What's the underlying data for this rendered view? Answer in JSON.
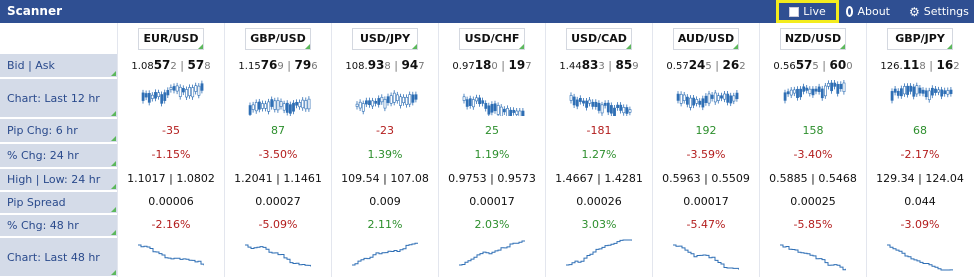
{
  "title": "Scanner",
  "toolbar": {
    "live": "Live",
    "about": "About",
    "settings": "Settings"
  },
  "row_labels": [
    "Bid | Ask",
    "Chart: Last 12 hr",
    "Pip Chg: 6 hr",
    "% Chg: 24 hr",
    "High | Low: 24 hr",
    "Pip Spread",
    "% Chg: 48 hr",
    "Chart: Last 48 hr"
  ],
  "pairs": [
    {
      "name": "EUR/USD",
      "bid_a": "1.08",
      "bid_b": "57",
      "bid_c": "2",
      "ask_a": "57",
      "ask_b": "8",
      "pip6": "-35",
      "pip6_dir": "neg",
      "chg24": "-1.15%",
      "chg24_dir": "neg",
      "high": "1.1017",
      "low": "1.0802",
      "spread": "0.00006",
      "chg48": "-2.16%",
      "chg48_dir": "neg"
    },
    {
      "name": "GBP/USD",
      "bid_a": "1.15",
      "bid_b": "76",
      "bid_c": "9",
      "ask_a": "79",
      "ask_b": "6",
      "pip6": "87",
      "pip6_dir": "pos",
      "chg24": "-3.50%",
      "chg24_dir": "neg",
      "high": "1.2041",
      "low": "1.1461",
      "spread": "0.00027",
      "chg48": "-5.09%",
      "chg48_dir": "neg"
    },
    {
      "name": "USD/JPY",
      "bid_a": "108.",
      "bid_b": "93",
      "bid_c": "8",
      "ask_a": "94",
      "ask_b": "7",
      "pip6": "-23",
      "pip6_dir": "neg",
      "chg24": "1.39%",
      "chg24_dir": "pos",
      "high": "109.54",
      "low": "107.08",
      "spread": "0.009",
      "chg48": "2.11%",
      "chg48_dir": "pos"
    },
    {
      "name": "USD/CHF",
      "bid_a": "0.97",
      "bid_b": "18",
      "bid_c": "0",
      "ask_a": "19",
      "ask_b": "7",
      "pip6": "25",
      "pip6_dir": "pos",
      "chg24": "1.19%",
      "chg24_dir": "pos",
      "high": "0.9753",
      "low": "0.9573",
      "spread": "0.00017",
      "chg48": "2.03%",
      "chg48_dir": "pos"
    },
    {
      "name": "USD/CAD",
      "bid_a": "1.44",
      "bid_b": "83",
      "bid_c": "3",
      "ask_a": "85",
      "ask_b": "9",
      "pip6": "-181",
      "pip6_dir": "neg",
      "chg24": "1.27%",
      "chg24_dir": "pos",
      "high": "1.4667",
      "low": "1.4281",
      "spread": "0.00026",
      "chg48": "3.03%",
      "chg48_dir": "pos"
    },
    {
      "name": "AUD/USD",
      "bid_a": "0.57",
      "bid_b": "24",
      "bid_c": "5",
      "ask_a": "26",
      "ask_b": "2",
      "pip6": "192",
      "pip6_dir": "pos",
      "chg24": "-3.59%",
      "chg24_dir": "neg",
      "high": "0.5963",
      "low": "0.5509",
      "spread": "0.00017",
      "chg48": "-5.47%",
      "chg48_dir": "neg"
    },
    {
      "name": "NZD/USD",
      "bid_a": "0.56",
      "bid_b": "57",
      "bid_c": "5",
      "ask_a": "60",
      "ask_b": "0",
      "pip6": "158",
      "pip6_dir": "pos",
      "chg24": "-3.40%",
      "chg24_dir": "neg",
      "high": "0.5885",
      "low": "0.5468",
      "spread": "0.00025",
      "chg48": "-5.85%",
      "chg48_dir": "neg"
    },
    {
      "name": "GBP/JPY",
      "bid_a": "126.",
      "bid_b": "11",
      "bid_c": "8",
      "ask_a": "16",
      "ask_b": "2",
      "pip6": "68",
      "pip6_dir": "pos",
      "chg24": "-2.17%",
      "chg24_dir": "neg",
      "high": "129.34",
      "low": "124.04",
      "spread": "0.044",
      "chg48": "-3.09%",
      "chg48_dir": "neg"
    }
  ],
  "colors": {
    "header": "#2f4f92",
    "label_bg": "#d4dbe8",
    "label_text": "#2a4a8c",
    "up": "#2d8f2d",
    "down": "#b31d1d",
    "candle": "#2f6fb5",
    "highlight": "#f3ec1e"
  }
}
